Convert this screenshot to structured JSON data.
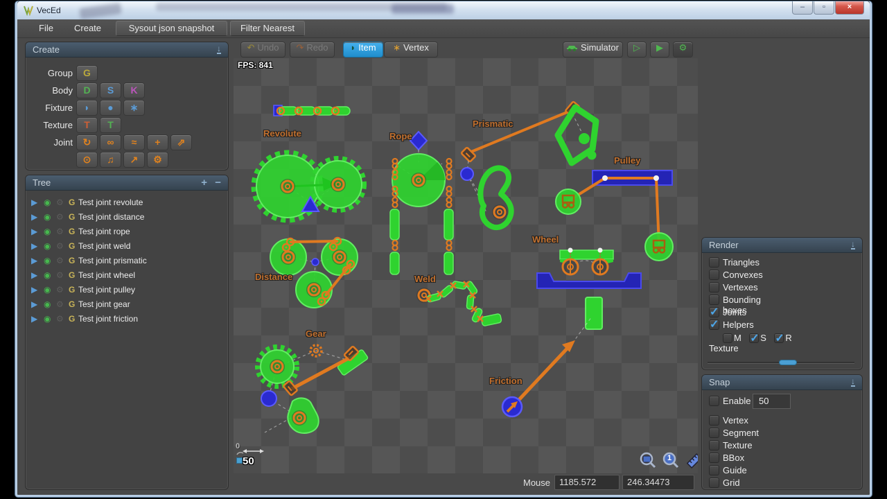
{
  "window": {
    "title": "VecEd"
  },
  "titlebar_controls": {
    "minimize": "–",
    "maximize": "▫",
    "close": "×"
  },
  "menubar": {
    "file": "File",
    "create": "Create",
    "sysout": "Sysout json snapshot",
    "filter_nearest": "Filter Nearest"
  },
  "toolbar": {
    "undo": "Undo",
    "redo": "Redo",
    "item": "Item",
    "vertex": "Vertex",
    "simulator": "Simulator"
  },
  "icons": {
    "collapse": "↓",
    "tree_add": "+",
    "tree_remove": "−",
    "check": "✓",
    "undo": "↶",
    "redo": "↷",
    "item_blob": "◗",
    "vertex_star": "∗",
    "play": "▷",
    "play_fast": "▶",
    "sim_gear": "⚙",
    "tree_expand": "▶",
    "eye": "◉",
    "gear": "⚙",
    "group_badge": "G",
    "zoom_one": "1"
  },
  "create_panel": {
    "title": "Create",
    "rows": [
      {
        "label": "Group",
        "buttons": [
          {
            "glyph": "G"
          }
        ]
      },
      {
        "label": "Body",
        "buttons": [
          {
            "glyph": "D"
          },
          {
            "glyph": "S"
          },
          {
            "glyph": "K"
          }
        ]
      },
      {
        "label": "Fixture",
        "buttons": [
          {
            "glyph": "◗"
          },
          {
            "glyph": "●"
          },
          {
            "glyph": "∗"
          }
        ]
      },
      {
        "label": "Texture",
        "buttons": [
          {
            "glyph": "T"
          },
          {
            "glyph": "T"
          }
        ]
      },
      {
        "label": "Joint",
        "buttons": [
          {
            "glyph": "↻"
          },
          {
            "glyph": "∞"
          },
          {
            "glyph": "≈"
          },
          {
            "glyph": "+"
          },
          {
            "glyph": "⇗"
          }
        ]
      },
      {
        "label": "",
        "buttons": [
          {
            "glyph": "⊙"
          },
          {
            "glyph": "♫"
          },
          {
            "glyph": "↗"
          },
          {
            "glyph": "⚙"
          }
        ]
      }
    ]
  },
  "tree_panel": {
    "title": "Tree",
    "items": [
      "Test joint revolute",
      "Test joint distance",
      "Test joint rope",
      "Test joint weld",
      "Test joint prismatic",
      "Test joint wheel",
      "Test joint pulley",
      "Test joint gear",
      "Test joint friction"
    ]
  },
  "canvas": {
    "fps": "FPS: 841",
    "scale_origin": "0",
    "scale_value": "50",
    "labels": {
      "revolute": "Revolute",
      "rope": "Rope",
      "prismatic": "Prismatic",
      "pulley": "Pulley",
      "distance": "Distance",
      "weld": "Weld",
      "wheel": "Wheel",
      "gear": "Gear",
      "friction": "Friction"
    }
  },
  "render_panel": {
    "title": "Render",
    "options": [
      {
        "label": "Triangles",
        "checked": false
      },
      {
        "label": "Convexes",
        "checked": false
      },
      {
        "label": "Vertexes",
        "checked": false
      },
      {
        "label": "Bounding boxes",
        "checked": false
      },
      {
        "label": "Joints",
        "checked": true
      },
      {
        "label": "Helpers",
        "checked": true
      }
    ],
    "msr": [
      {
        "label": "M",
        "checked": false
      },
      {
        "label": "S",
        "checked": true
      },
      {
        "label": "R",
        "checked": true
      }
    ],
    "texture_label": "Texture"
  },
  "snap_panel": {
    "title": "Snap",
    "enable_label": "Enable",
    "snap_value": "50",
    "options": [
      "Vertex",
      "Segment",
      "Texture",
      "BBox",
      "Guide",
      "Grid"
    ]
  },
  "statusbar": {
    "mouse_label": "Mouse",
    "mouse_x": "1185.572",
    "mouse_y": "246.34473"
  },
  "colors": {
    "accent_blue": "#2e9fe6",
    "shape_green": "#2fd32f",
    "joint_orange": "#e07a20",
    "shape_blue": "#2a2ad0",
    "label_orange": "#c1702f"
  }
}
